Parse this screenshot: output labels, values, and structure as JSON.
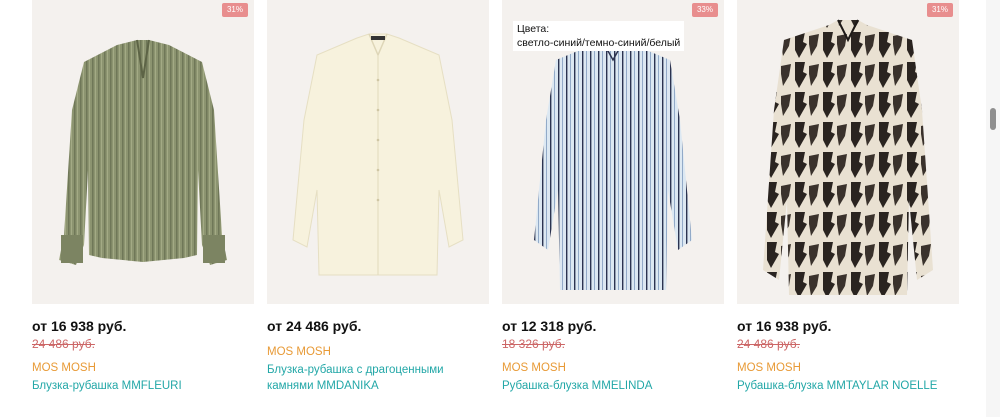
{
  "products": [
    {
      "discount": "31%",
      "price": "от 16 938 руб.",
      "old_price": "24 486 руб.",
      "brand": "MOS MOSH",
      "name": "Блузка-рубашка MMFLEURI",
      "colors_label": "",
      "colors_value": ""
    },
    {
      "discount": "",
      "price": "от 24 486 руб.",
      "old_price": "",
      "brand": "MOS MOSH",
      "name": "Блузка-рубашка с драгоценными камнями MMDANIKA",
      "colors_label": "",
      "colors_value": ""
    },
    {
      "discount": "33%",
      "price": "от 12 318 руб.",
      "old_price": "18 326 руб.",
      "brand": "MOS MOSH",
      "name": "Рубашка-блузка MMELINDA",
      "colors_label": "Цвета:",
      "colors_value": "светло-синий/темно-синий/белый"
    },
    {
      "discount": "31%",
      "price": "от 16 938 руб.",
      "old_price": "24 486 руб.",
      "brand": "MOS MOSH",
      "name": "Рубашка-блузка MMTAYLAR NOELLE",
      "colors_label": "",
      "colors_value": ""
    }
  ],
  "colors": {
    "discount_badge": "#e88e8e",
    "brand": "#e89a36",
    "product_name": "#22a7a7",
    "old_price": "#cc6666",
    "image_bg": "#f4f1ee"
  }
}
